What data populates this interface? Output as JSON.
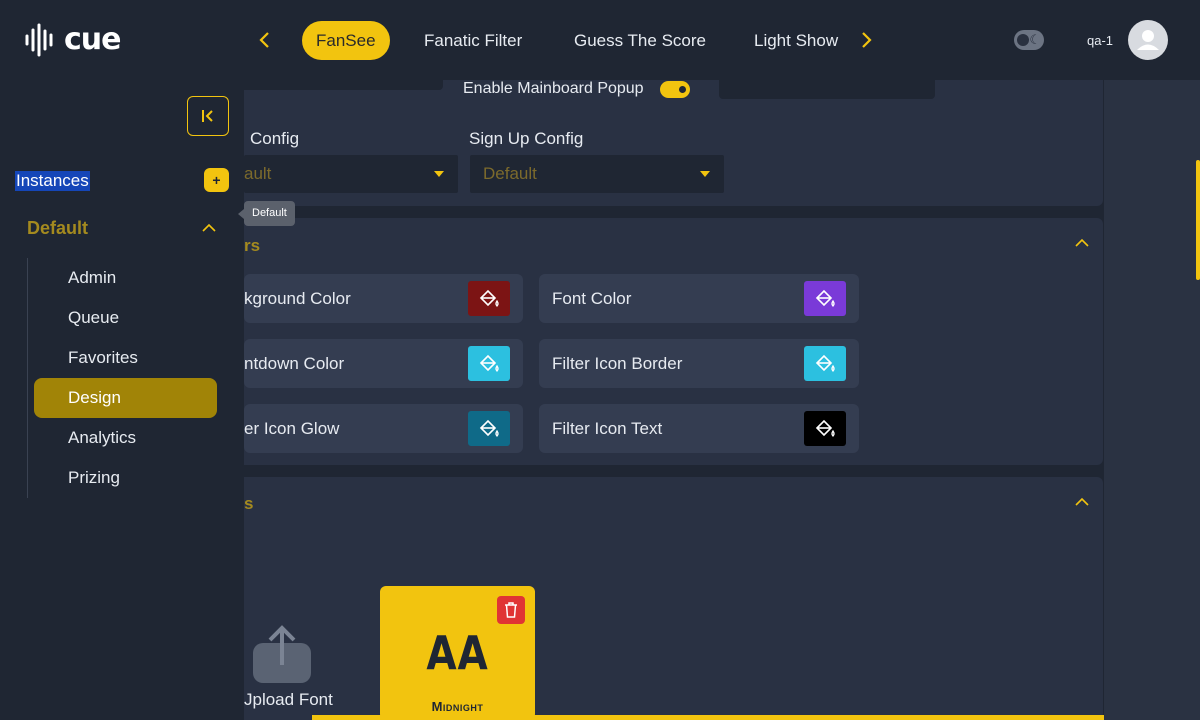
{
  "header": {
    "logo_text": "cue",
    "tabs": [
      {
        "label": "FanSee",
        "active": true
      },
      {
        "label": "Fanatic Filter",
        "active": false
      },
      {
        "label": "Guess The Score",
        "active": false
      },
      {
        "label": "Light Show",
        "active": false
      }
    ],
    "username": "qa-1",
    "icons": {
      "prev": "chevron-left-icon",
      "next": "chevron-right-icon",
      "theme": "moon-icon",
      "avatar": "user-icon"
    }
  },
  "sidebar": {
    "instances_label": "Instances",
    "add_label": "+",
    "instance_name": "Default",
    "tooltip": "Default",
    "menu": [
      {
        "label": "Admin",
        "active": false
      },
      {
        "label": "Queue",
        "active": false
      },
      {
        "label": "Favorites",
        "active": false
      },
      {
        "label": "Design",
        "active": true
      },
      {
        "label": "Analytics",
        "active": false
      },
      {
        "label": "Prizing",
        "active": false
      }
    ]
  },
  "settings": {
    "toggle_label": "Enable Mainboard Popup",
    "toggle_on": true,
    "config_left_label": "Config",
    "config_left_value": "ault",
    "config_right_label": "Sign Up Config",
    "config_right_value": "Default"
  },
  "colors_section": {
    "title": "rs",
    "items": [
      {
        "label": "kground Color",
        "color": "#7c1414"
      },
      {
        "label": "Font Color",
        "color": "#7a3ad8"
      },
      {
        "label": "ntdown Color",
        "color": "#2cc0e0"
      },
      {
        "label": "Filter Icon Border",
        "color": "#2cc0e0"
      },
      {
        "label": "er Icon Glow",
        "color": "#0f6a88"
      },
      {
        "label": "Filter Icon Text",
        "color": "#000000"
      }
    ]
  },
  "fonts_section": {
    "title": "s",
    "upload_label": "Jpload Font",
    "font_card_preview": "AA",
    "font_card_name": "Midnight"
  },
  "theme": {
    "accent": "#f2c40f",
    "background": "#1f2633",
    "panel": "#293143"
  }
}
